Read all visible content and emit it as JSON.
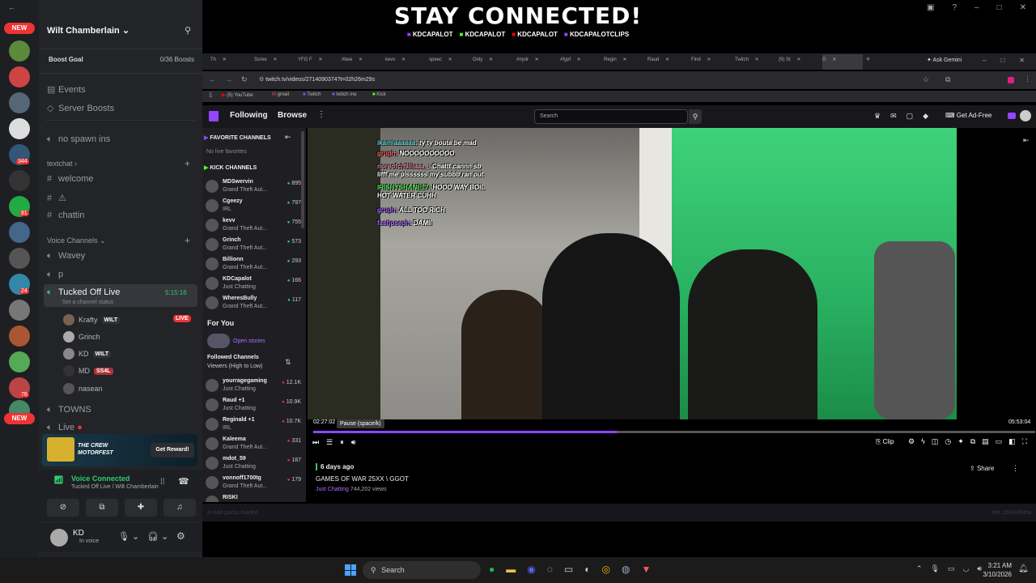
{
  "overlay": {
    "title": "STAY CONNECTED!",
    "socials": [
      "KDCAPALOT",
      "KDCAPALOT",
      "KDCAPALOT",
      "KDCAPALOTCLIPS"
    ]
  },
  "discord": {
    "server_name": "Wilt Chamberlain",
    "boost_goal": "Boost Goal",
    "boost_count": "0/36 Boosts",
    "events": "Events",
    "server_boosts": "Server Boosts",
    "no_spawn": "no spawn ins",
    "textchat_category": "textchat",
    "welcome": "welcome",
    "warning_channel": "⚠",
    "chattin": "chattin",
    "voice_category": "Voice Channels",
    "wavey": "Wavey",
    "p": "p",
    "tucked_off": "Tucked Off Live",
    "tucked_timer": "5:15:16",
    "channel_status": "Set a channel status",
    "live_badge": "LIVE",
    "voice_users": [
      {
        "name": "Krafty",
        "tag": "WILT"
      },
      {
        "name": "Grinch",
        "tag": ""
      },
      {
        "name": "KD",
        "tag": "WILT"
      },
      {
        "name": "MD",
        "tag": "SS4L"
      },
      {
        "name": "nasean",
        "tag": ""
      }
    ],
    "towns": "TOWNS",
    "live_ch": "Live",
    "promo_btn": "Get Reward!",
    "promo_logo": "THE CREW MOTORFEST",
    "voice_connected": "Voice Connected",
    "voice_sub": "Tucked Off Live / Wilt Chamberlain",
    "user_name": "KD",
    "user_status": "In voice",
    "rail_badges": [
      "NEW",
      "81",
      "344",
      "24",
      "76",
      "NEW"
    ]
  },
  "browser": {
    "tabs": [
      "Th",
      "Scree",
      "YFG F",
      "#bee",
      "kevv",
      "speec",
      "Only",
      "#nydr",
      "#fypf",
      "Regin",
      "Raud",
      "Find",
      "Twitch",
      "(9) St",
      "G"
    ],
    "ask_gemini": "Ask Gemini",
    "url": "twitch.tv/videos/2714090374?t=02h26m29s",
    "bookmarks": [
      "(5) YouTube",
      "gmail",
      "Twitch",
      "twitch me",
      "Kick"
    ]
  },
  "twitch": {
    "following": "Following",
    "browse": "Browse",
    "search_placeholder": "Search",
    "get_ad_free": "Get Ad-Free",
    "favorite_channels": "FAVORITE CHANNELS",
    "no_favorites": "No live favorites",
    "kick_channels": "KICK CHANNELS",
    "kick_list": [
      {
        "name": "MDSwervin",
        "game": "Grand Theft Aut...",
        "viewers": "895"
      },
      {
        "name": "Cgeezy",
        "game": "IRL",
        "viewers": "797"
      },
      {
        "name": "kevv",
        "game": "Grand Theft Aut...",
        "viewers": "755"
      },
      {
        "name": "Grinch",
        "game": "Grand Theft Aut...",
        "viewers": "573"
      },
      {
        "name": "Billionn",
        "game": "Grand Theft Aut...",
        "viewers": "293"
      },
      {
        "name": "KDCapalot",
        "game": "Just Chatting",
        "viewers": "166"
      },
      {
        "name": "WheresBully",
        "game": "Grand Theft Aut...",
        "viewers": "117"
      }
    ],
    "for_you": "For You",
    "open_stories": "Open stories",
    "followed_channels": "Followed Channels",
    "followed_sort": "Viewers (High to Low)",
    "followed_list": [
      {
        "name": "yourragegaming",
        "game": "Just Chatting",
        "viewers": "12.1K"
      },
      {
        "name": "Raud +1",
        "game": "Just Chatting",
        "viewers": "10.9K"
      },
      {
        "name": "Reginald +1",
        "game": "IRL",
        "viewers": "10.7K"
      },
      {
        "name": "Kaleema",
        "game": "Grand Theft Aut...",
        "viewers": "331"
      },
      {
        "name": "mdot_59",
        "game": "Just Chatting",
        "viewers": "187"
      },
      {
        "name": "vonnoff1700tg",
        "game": "Grand Theft Aut...",
        "viewers": "179"
      },
      {
        "name": "RISKI",
        "game": "",
        "viewers": ""
      }
    ],
    "chat_overlay": [
      {
        "user": "ikamiaaaaaa:",
        "msg": "ty ty bouta be mad"
      },
      {
        "user": "gruph:",
        "msg": "NOOOOOOOOOO"
      },
      {
        "user": "noreofch3lilaaa_:",
        "msg": "Chattt cannn sb"
      },
      {
        "user": "",
        "msg": "lifff me plssssss my subbb ran out"
      },
      {
        "user": "IRISHYSHANE17:",
        "msg": "HOOD WAY BOIL"
      },
      {
        "user": "",
        "msg": "HOT WATER CUHH"
      },
      {
        "user": "gruph:",
        "msg": "ALL TOO RICH"
      },
      {
        "user": "fastjoseph:",
        "msg": "DAMII"
      }
    ],
    "time_current": "02:27:02",
    "time_total": "05:53:04",
    "progress": 0.42,
    "pause_tooltip": "Pause (space/k)",
    "clip": "Clip",
    "vod_age": "6 days ago",
    "vod_title": "GAMES OF WAR 25XX \\ GGOT",
    "vod_category": "Just Chatting",
    "vod_views": "744,202 views",
    "share": "Share",
    "mod_packs": "8 mod packs loaded",
    "version": "Ver. 26194/beta"
  },
  "taskbar": {
    "search": "Search",
    "time": "3:21 AM",
    "date": "3/10/2026"
  }
}
